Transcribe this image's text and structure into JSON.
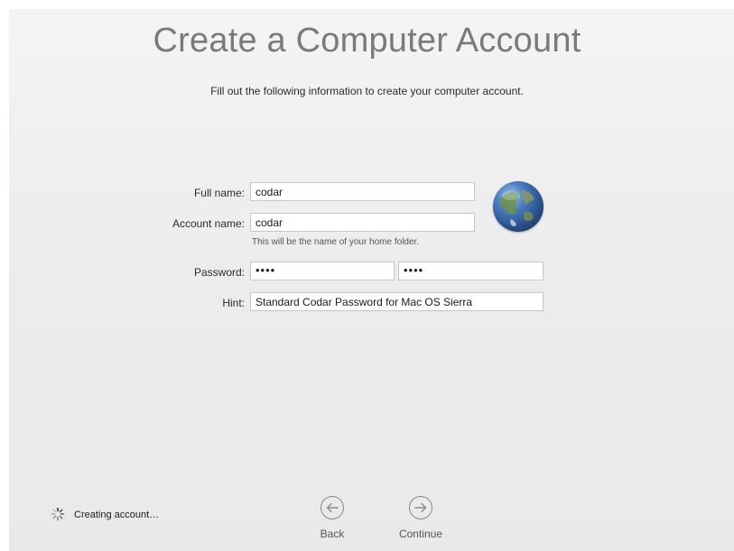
{
  "header": {
    "title": "Create a Computer Account",
    "subtitle": "Fill out the following information to create your computer account."
  },
  "form": {
    "full_name_label": "Full name:",
    "full_name_value": "codar",
    "account_name_label": "Account name:",
    "account_name_value": "codar",
    "account_name_help": "This will be the name of your home folder.",
    "password_label": "Password:",
    "password_value": "••••",
    "verify_value": "••••",
    "hint_label": "Hint:",
    "hint_value": "Standard Codar Password for Mac OS Sierra"
  },
  "avatar": {
    "icon": "globe-icon"
  },
  "footer": {
    "status_text": "Creating account…",
    "back_label": "Back",
    "continue_label": "Continue"
  },
  "colors": {
    "title": "#7a7a7a",
    "background": "#ececec",
    "field_border": "#c6c6c6"
  }
}
